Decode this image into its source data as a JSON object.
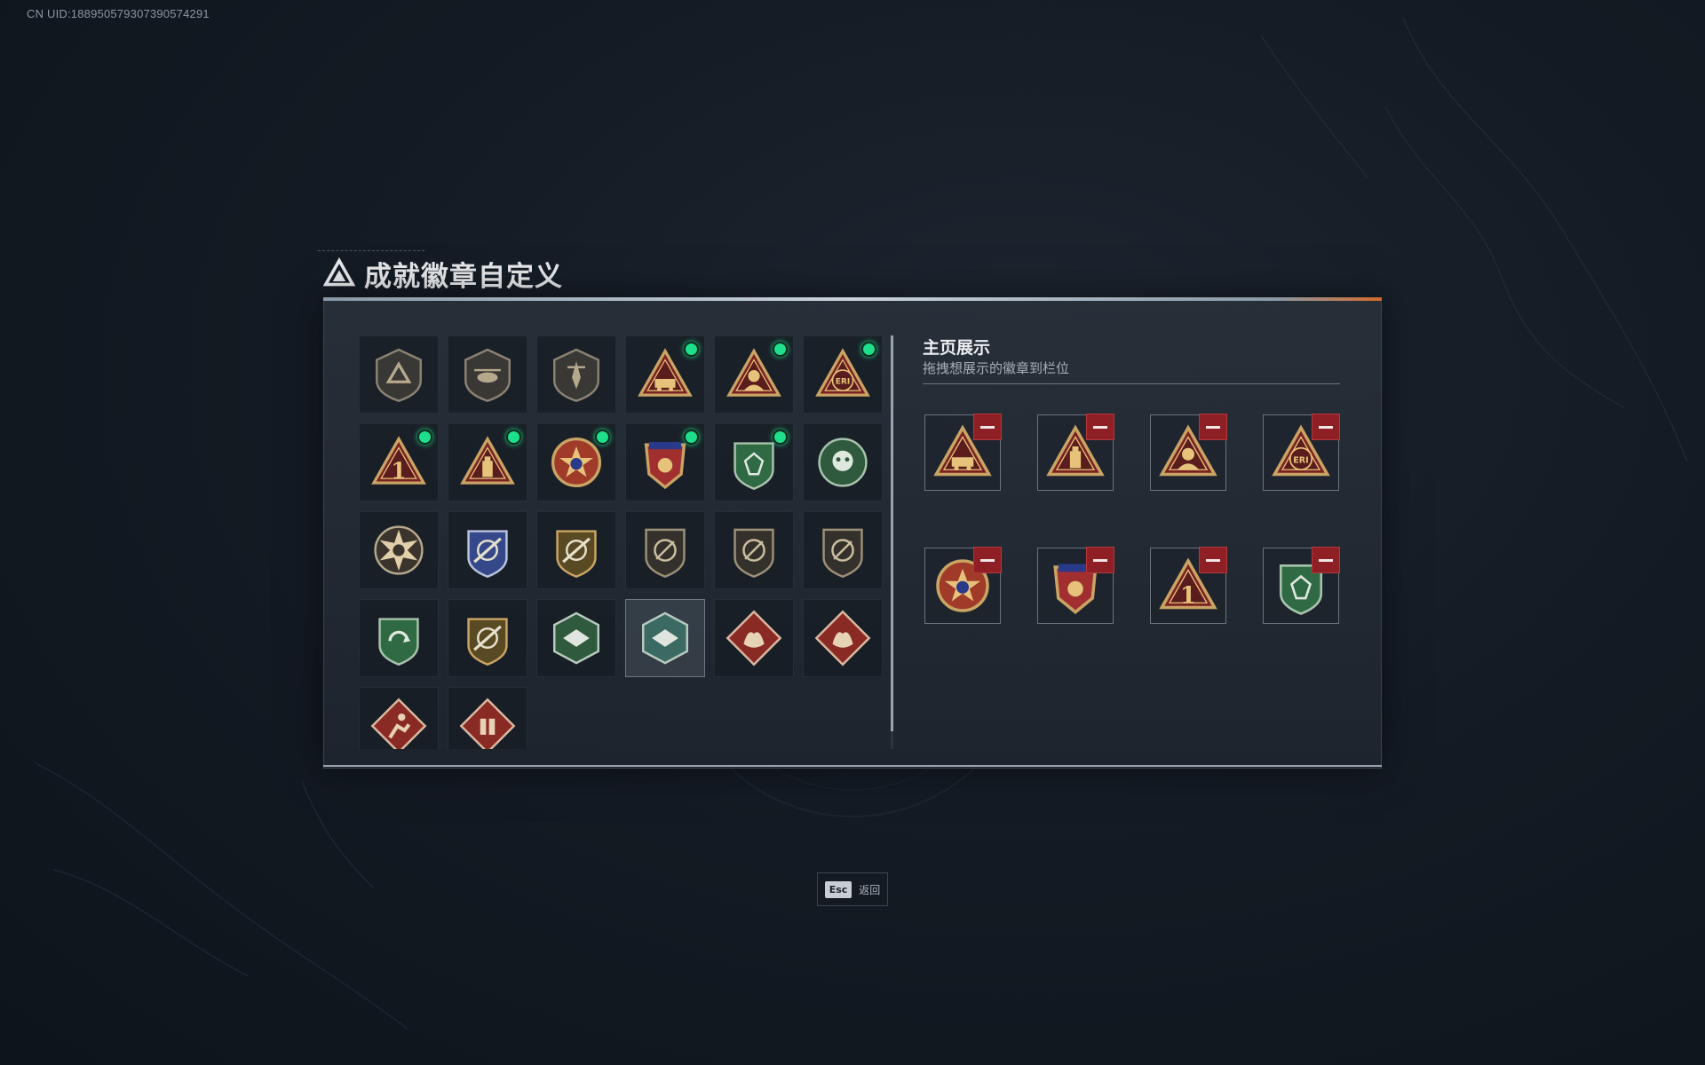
{
  "uid_text": "CN UID:18895057930739057429​1",
  "title": "成就徽章自定义",
  "showcase": {
    "title": "主页展示",
    "subtitle": "拖拽想展示的徽章到栏位"
  },
  "esc": {
    "key": "Esc",
    "label": "返回"
  },
  "colors": {
    "new_dot": "#1ee08c",
    "remove_button": "#8e1f24",
    "accent_bar_end": "#d36a2c"
  },
  "badges": [
    {
      "icon": "shield-triangle-badge-icon",
      "new": false
    },
    {
      "icon": "helicopter-shield-badge-icon",
      "new": false
    },
    {
      "icon": "dagger-shield-badge-icon",
      "new": false
    },
    {
      "icon": "vehicle-triangle-badge-icon",
      "new": true
    },
    {
      "icon": "soldier-triangle-badge-icon",
      "new": true
    },
    {
      "icon": "eri-globe-triangle-badge-icon",
      "new": true
    },
    {
      "icon": "number-one-triangle-badge-icon",
      "new": true
    },
    {
      "icon": "usb-triangle-badge-icon",
      "new": true
    },
    {
      "icon": "star-medal-badge-icon",
      "new": true
    },
    {
      "icon": "crest-medal-badge-icon",
      "new": true
    },
    {
      "icon": "green-gem-shield-badge-icon",
      "new": true
    },
    {
      "icon": "green-skull-badge-icon",
      "new": false
    },
    {
      "icon": "sunburst-medal-badge-icon",
      "new": false
    },
    {
      "icon": "blue-crosshair-badge-icon",
      "new": false
    },
    {
      "icon": "gold-crosshair-badge-icon",
      "new": false
    },
    {
      "icon": "dark-rifle-badge-icon-1",
      "new": false
    },
    {
      "icon": "dark-rifle-badge-icon-2",
      "new": false
    },
    {
      "icon": "dark-rifle-badge-icon-3",
      "new": false
    },
    {
      "icon": "green-arrows-badge-icon",
      "new": false
    },
    {
      "icon": "gold-wings-badge-icon",
      "new": false
    },
    {
      "icon": "green-hawk-hex-badge-icon",
      "new": false
    },
    {
      "icon": "teal-hex-soldier-badge-icon",
      "new": false,
      "selected": true
    },
    {
      "icon": "red-dragon-diamond-badge-icon-1",
      "new": false
    },
    {
      "icon": "red-dragon-diamond-badge-icon-2",
      "new": false
    },
    {
      "icon": "red-runner-diamond-badge-icon",
      "new": false
    },
    {
      "icon": "red-vest-diamond-badge-icon",
      "new": false
    }
  ],
  "showcase_slots": [
    {
      "icon": "vehicle-triangle-badge-icon"
    },
    {
      "icon": "usb-triangle-badge-icon"
    },
    {
      "icon": "soldier-triangle-badge-icon"
    },
    {
      "icon": "eri-globe-triangle-badge-icon"
    },
    {
      "icon": "star-medal-badge-icon"
    },
    {
      "icon": "crest-medal-badge-icon"
    },
    {
      "icon": "number-one-triangle-badge-icon"
    },
    {
      "icon": "green-gem-shield-badge-icon"
    }
  ]
}
